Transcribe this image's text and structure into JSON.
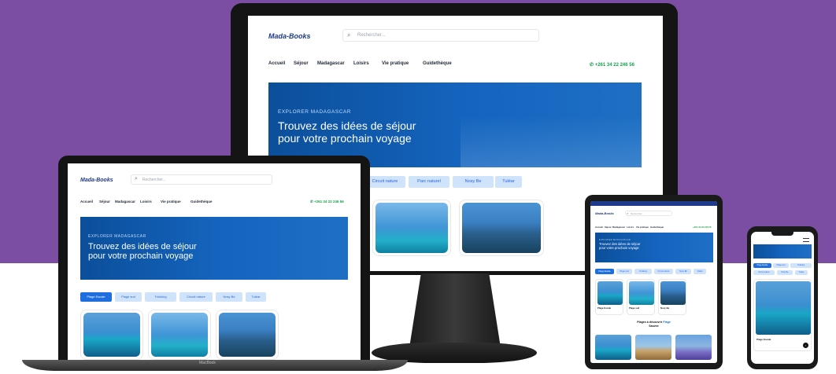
{
  "colors": {
    "background_band": "#7b4ea3",
    "accent": "#1d6fe0",
    "chip": "#cfe3fb",
    "hero": "#0b4f9a",
    "phone_green": "#16a34a"
  },
  "site": {
    "logo": "Mada-Books",
    "search_placeholder": "Rechercher...",
    "nav": [
      "Accueil",
      "Séjour",
      "Madagascar",
      "Loisirs",
      "Vie pratique",
      "Guidethèque"
    ],
    "phone": "+261 34 22 246 56",
    "hero": {
      "eyebrow": "EXPLORER MADAGASCAR",
      "title_line1": "Trouvez des idées de séjour",
      "title_line2": "pour votre prochain voyage"
    },
    "chips": [
      "Plage Escale",
      "Plage sud",
      "Trekking",
      "Circuit nature",
      "Nosy Be",
      "Tuléar"
    ]
  },
  "desktop": {
    "chips": [
      "Circuit nature",
      "Parc naturel",
      "Nosy Be",
      "Tuléar"
    ]
  },
  "laptop": {
    "brand": "MacBook"
  },
  "tablet": {
    "section_line1": "Plages à découvrir ",
    "section_highlight": "Plage",
    "section_line2": "Sauvée",
    "card_labels": [
      "Plage Escale",
      "Plage sud",
      "Nosy Be"
    ]
  },
  "mobile": {
    "card_label": "Plage Escale"
  }
}
